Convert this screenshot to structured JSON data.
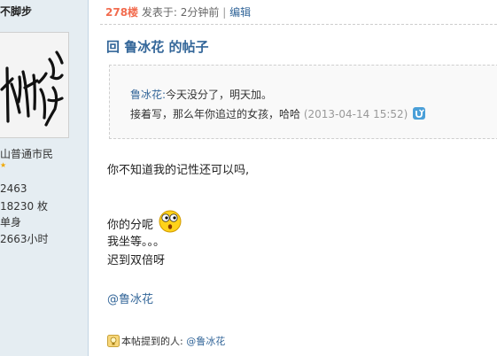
{
  "sidebar": {
    "username": "不脚步",
    "rank": "山普通市民",
    "stats": [
      "2463",
      "18230 枚",
      "单身",
      "2663小时"
    ]
  },
  "post": {
    "floor": "278楼",
    "posted_label": "发表于:",
    "posted_time": "2分钟前",
    "separator": "|",
    "edit_label": "编辑",
    "reply_title": "回  鲁冰花  的帖子",
    "quote": {
      "author": "鲁冰花:",
      "line1_text": "今天没分了，明天加。",
      "line2_text": "接着写，那么年你追过的女孩，哈哈",
      "date": "(2013-04-14 15:52)"
    },
    "body_lines": [
      "你不知道我的记性还可以吗,",
      "你的分呢",
      "我坐等。。。",
      "迟到双倍呀"
    ],
    "mention": "@鲁冰花",
    "mentioned_label": "本帖提到的人:",
    "mentioned_user": "@鲁冰花"
  },
  "icons": {
    "back": "back-arrow-icon",
    "smiley": "surprised-smiley-icon",
    "mention": "lightbulb-icon"
  },
  "colors": {
    "link": "#336699",
    "floor": "#f26c4f",
    "sidebar_bg": "#e5edf2"
  }
}
